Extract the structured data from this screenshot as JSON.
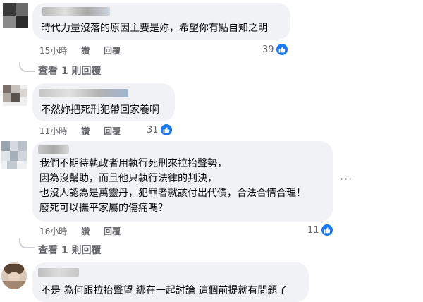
{
  "comments": [
    {
      "text_lines": [
        "時代力量沒落的原因主要是妳，希望你有點自知之明"
      ],
      "time": "15小時",
      "like_action": "讚",
      "reply_action": "回覆",
      "like_count": "39",
      "view_replies": "查看 1 則回覆"
    },
    {
      "text_lines": [
        "不然妳把死刑犯帶回家養啊"
      ],
      "time": "11小時",
      "like_action": "讚",
      "reply_action": "回覆",
      "like_count": "31"
    },
    {
      "text_lines": [
        "我們不期待執政者用執行死刑來拉抬聲勢，",
        "因為沒幫助，而且他只執行法律的判決，",
        "也沒人認為是萬靈丹，犯罪者就該付出代價，合法合情合理！",
        "廢死可以撫平家屬的傷痛嗎？"
      ],
      "time": "16小時",
      "like_action": "讚",
      "reply_action": "回覆",
      "like_count": "11",
      "view_replies": "查看 1 則回覆"
    },
    {
      "text_lines": [
        "不是 為何跟拉抬聲望 綁在一起討論 這個前提就有問題了"
      ]
    }
  ],
  "icons": {
    "like": "thumbs-up-icon",
    "more": "more-options-icon"
  },
  "colors": {
    "like_blue": "#1877f2",
    "bubble_bg": "#f0f2f5",
    "meta_text": "#65676b"
  }
}
